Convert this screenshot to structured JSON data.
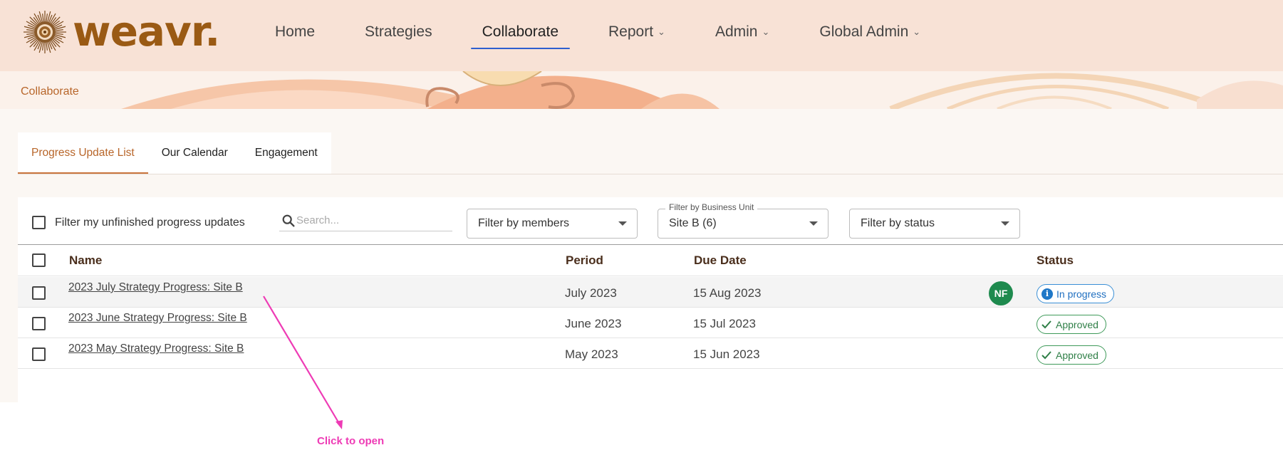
{
  "brand": {
    "name": "weavr."
  },
  "nav": {
    "items": [
      {
        "label": "Home",
        "active": false,
        "dropdown": false
      },
      {
        "label": "Strategies",
        "active": false,
        "dropdown": false
      },
      {
        "label": "Collaborate",
        "active": true,
        "dropdown": false
      },
      {
        "label": "Report",
        "active": false,
        "dropdown": true
      },
      {
        "label": "Admin",
        "active": false,
        "dropdown": true
      },
      {
        "label": "Global Admin",
        "active": false,
        "dropdown": true
      }
    ]
  },
  "breadcrumb": {
    "current": "Collaborate"
  },
  "tabs": [
    {
      "label": "Progress Update List",
      "active": true
    },
    {
      "label": "Our Calendar",
      "active": false
    },
    {
      "label": "Engagement",
      "active": false
    }
  ],
  "filters": {
    "unfinished_label": "Filter my unfinished progress updates",
    "search_placeholder": "Search...",
    "members_placeholder": "Filter by members",
    "business_unit_label": "Filter by Business Unit",
    "business_unit_value": "Site B (6)",
    "status_placeholder": "Filter by status"
  },
  "table": {
    "columns": {
      "name": "Name",
      "period": "Period",
      "due_date": "Due Date",
      "status": "Status"
    },
    "rows": [
      {
        "name": "2023 July Strategy Progress: Site B",
        "period": "July 2023",
        "due_date": "15 Aug 2023",
        "assignee_initials": "NF",
        "status": "In progress",
        "status_type": "in-progress"
      },
      {
        "name": "2023 June Strategy Progress: Site B",
        "period": "June 2023",
        "due_date": "15 Jul 2023",
        "assignee_initials": "",
        "status": "Approved",
        "status_type": "approved"
      },
      {
        "name": "2023 May Strategy Progress: Site B",
        "period": "May 2023",
        "due_date": "15 Jun 2023",
        "assignee_initials": "",
        "status": "Approved",
        "status_type": "approved"
      }
    ]
  },
  "annotation": {
    "text": "Click to open",
    "color": "#ee3bb5"
  },
  "colors": {
    "brand": "#9a5a14",
    "header_bg": "#f8e2d6",
    "accent": "#b8662a",
    "nav_underline": "#2f5fcf",
    "avatar": "#1e8a4e",
    "in_progress": "#1f6fc0",
    "approved": "#2f7f47"
  }
}
